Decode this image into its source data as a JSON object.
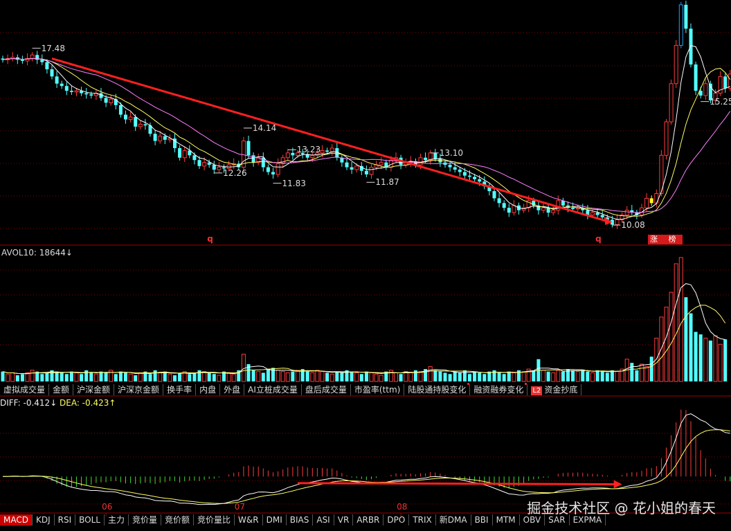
{
  "chart_data": {
    "type": "candlestick",
    "colors": {
      "up": "#ff3b3b",
      "down": "#54ffff",
      "ma5": "#ffffff",
      "ma10": "#ffff66",
      "ma20": "#ff80ff",
      "trend": "#ff2020",
      "limit_up": "#ffff20",
      "grid": "#8b0000"
    },
    "price_panel": {
      "ylim": [
        9.3,
        19.5
      ],
      "annotations": [
        {
          "label": "17.48",
          "i": 6,
          "value": 17.48
        },
        {
          "label": "14.14",
          "i": 49,
          "value": 14.14
        },
        {
          "label": "12.26",
          "i": 43,
          "value": 12.26
        },
        {
          "label": "13.23",
          "i": 58,
          "value": 13.23
        },
        {
          "label": "11.83",
          "i": 55,
          "value": 11.83
        },
        {
          "label": "11.87",
          "i": 74,
          "value": 11.87
        },
        {
          "label": "13.10",
          "i": 87,
          "value": 13.1
        },
        {
          "label": "10.08",
          "i": 124,
          "value": 10.08
        },
        {
          "label": "15.25",
          "i": 142,
          "value": 15.25
        }
      ],
      "markers": [
        {
          "label": "q",
          "i": 42
        },
        {
          "label": "q",
          "i": 121
        }
      ],
      "tag": "涨 榜",
      "trend_line": [
        [
          10,
          17.05
        ],
        [
          124,
          10.2
        ]
      ]
    },
    "volume_panel": {
      "title": "AVOL10: 18644↓",
      "ylim": [
        0,
        100
      ]
    },
    "macd_panel": {
      "title_diff": "DIFF: -0.412↓",
      "title_dea": "DEA: -0.423↑",
      "ylim": [
        -1.0,
        1.9
      ]
    },
    "x_months": [
      {
        "label": "06",
        "i": 21
      },
      {
        "label": "07",
        "i": 48
      },
      {
        "label": "08",
        "i": 81
      }
    ],
    "bars": {
      "closes": [
        17.0,
        17.05,
        17.1,
        17.0,
        16.95,
        17.05,
        17.2,
        17.0,
        16.9,
        16.6,
        16.3,
        16.0,
        15.9,
        15.7,
        15.65,
        15.7,
        15.6,
        15.55,
        15.5,
        15.6,
        15.4,
        15.2,
        15.35,
        15.1,
        14.7,
        14.5,
        14.6,
        14.2,
        14.3,
        14.25,
        13.9,
        13.6,
        13.8,
        13.65,
        13.7,
        13.3,
        12.9,
        13.2,
        13.0,
        12.8,
        12.55,
        12.7,
        12.6,
        12.4,
        12.5,
        12.45,
        12.6,
        12.65,
        12.5,
        13.6,
        13.0,
        12.7,
        12.9,
        12.5,
        12.3,
        12.2,
        12.65,
        12.9,
        13.1,
        13.0,
        13.1,
        13.05,
        12.9,
        13.0,
        13.1,
        13.2,
        13.15,
        13.3,
        12.9,
        12.7,
        12.5,
        12.4,
        12.55,
        12.35,
        12.2,
        12.5,
        12.6,
        12.7,
        12.5,
        12.8,
        12.9,
        12.6,
        12.7,
        12.75,
        12.6,
        12.9,
        12.8,
        13.1,
        12.85,
        12.7,
        12.6,
        12.5,
        12.4,
        12.3,
        12.15,
        12.1,
        12.0,
        11.9,
        11.7,
        11.5,
        11.2,
        11.0,
        10.8,
        10.6,
        10.9,
        10.7,
        10.8,
        11.1,
        10.9,
        10.7,
        10.8,
        10.6,
        10.7,
        11.1,
        10.9,
        10.8,
        10.75,
        10.8,
        10.7,
        10.5,
        10.6,
        10.5,
        10.4,
        10.3,
        10.1,
        10.3,
        10.5,
        10.7,
        10.6,
        10.5,
        10.8,
        11.2,
        11.0,
        11.4,
        13.0,
        14.4,
        16.0,
        17.6,
        19.3,
        18.3,
        16.8,
        15.7,
        15.5,
        16.0,
        15.3,
        15.6,
        16.3,
        15.8,
        16.4
      ],
      "opens": [
        17.05,
        17.0,
        17.05,
        17.1,
        17.0,
        16.95,
        17.05,
        17.2,
        17.0,
        16.9,
        16.6,
        16.3,
        16.0,
        15.9,
        15.7,
        15.65,
        15.7,
        15.6,
        15.55,
        15.5,
        15.6,
        15.4,
        15.2,
        15.35,
        15.1,
        14.7,
        14.5,
        14.6,
        14.2,
        14.3,
        14.25,
        13.9,
        13.6,
        13.8,
        13.65,
        13.7,
        13.3,
        12.9,
        13.2,
        13.0,
        12.8,
        12.55,
        12.7,
        12.6,
        12.4,
        12.5,
        12.45,
        12.6,
        12.65,
        12.5,
        13.6,
        13.0,
        12.7,
        12.9,
        12.5,
        12.3,
        12.2,
        12.65,
        12.9,
        13.1,
        13.0,
        13.1,
        13.05,
        12.9,
        13.0,
        13.1,
        13.2,
        13.15,
        13.3,
        12.9,
        12.7,
        12.5,
        12.4,
        12.55,
        12.35,
        12.2,
        12.5,
        12.6,
        12.7,
        12.5,
        12.8,
        12.9,
        12.6,
        12.7,
        12.75,
        12.6,
        12.9,
        12.8,
        13.1,
        12.85,
        12.7,
        12.6,
        12.5,
        12.4,
        12.3,
        12.15,
        12.1,
        12.0,
        11.9,
        11.7,
        11.5,
        11.2,
        11.0,
        10.8,
        10.6,
        10.9,
        10.7,
        10.8,
        11.1,
        10.9,
        10.7,
        10.8,
        10.6,
        10.7,
        11.1,
        10.9,
        10.8,
        10.75,
        10.8,
        10.7,
        10.5,
        10.6,
        10.5,
        10.4,
        10.3,
        10.1,
        10.3,
        10.5,
        10.7,
        10.6,
        10.5,
        10.8,
        11.2,
        11.0,
        11.4,
        13.0,
        14.4,
        16.0,
        17.6,
        19.3,
        18.3,
        16.8,
        15.7,
        15.5,
        16.0,
        15.3,
        15.6,
        16.3,
        15.8
      ],
      "volumes": [
        8,
        6,
        7,
        5,
        6,
        7,
        9,
        8,
        6,
        7,
        9,
        8,
        7,
        6,
        8,
        7,
        6,
        9,
        7,
        6,
        8,
        7,
        9,
        6,
        8,
        7,
        6,
        5,
        7,
        8,
        6,
        9,
        7,
        8,
        6,
        5,
        7,
        8,
        6,
        7,
        9,
        8,
        7,
        6,
        5,
        8,
        7,
        6,
        9,
        22,
        14,
        9,
        8,
        7,
        10,
        11,
        9,
        8,
        7,
        8,
        9,
        10,
        8,
        7,
        9,
        8,
        7,
        6,
        8,
        7,
        9,
        8,
        7,
        6,
        8,
        7,
        6,
        5,
        8,
        9,
        7,
        6,
        8,
        7,
        9,
        8,
        10,
        12,
        9,
        8,
        7,
        6,
        8,
        7,
        9,
        6,
        8,
        7,
        6,
        8,
        9,
        7,
        6,
        8,
        7,
        9,
        8,
        10,
        9,
        18,
        9,
        8,
        7,
        9,
        8,
        10,
        9,
        8,
        9,
        8,
        7,
        9,
        8,
        7,
        9,
        8,
        10,
        18,
        15,
        9,
        14,
        12,
        20,
        35,
        52,
        60,
        72,
        95,
        100,
        68,
        55,
        40,
        38,
        35,
        33,
        37,
        30,
        34
      ]
    }
  }
}
